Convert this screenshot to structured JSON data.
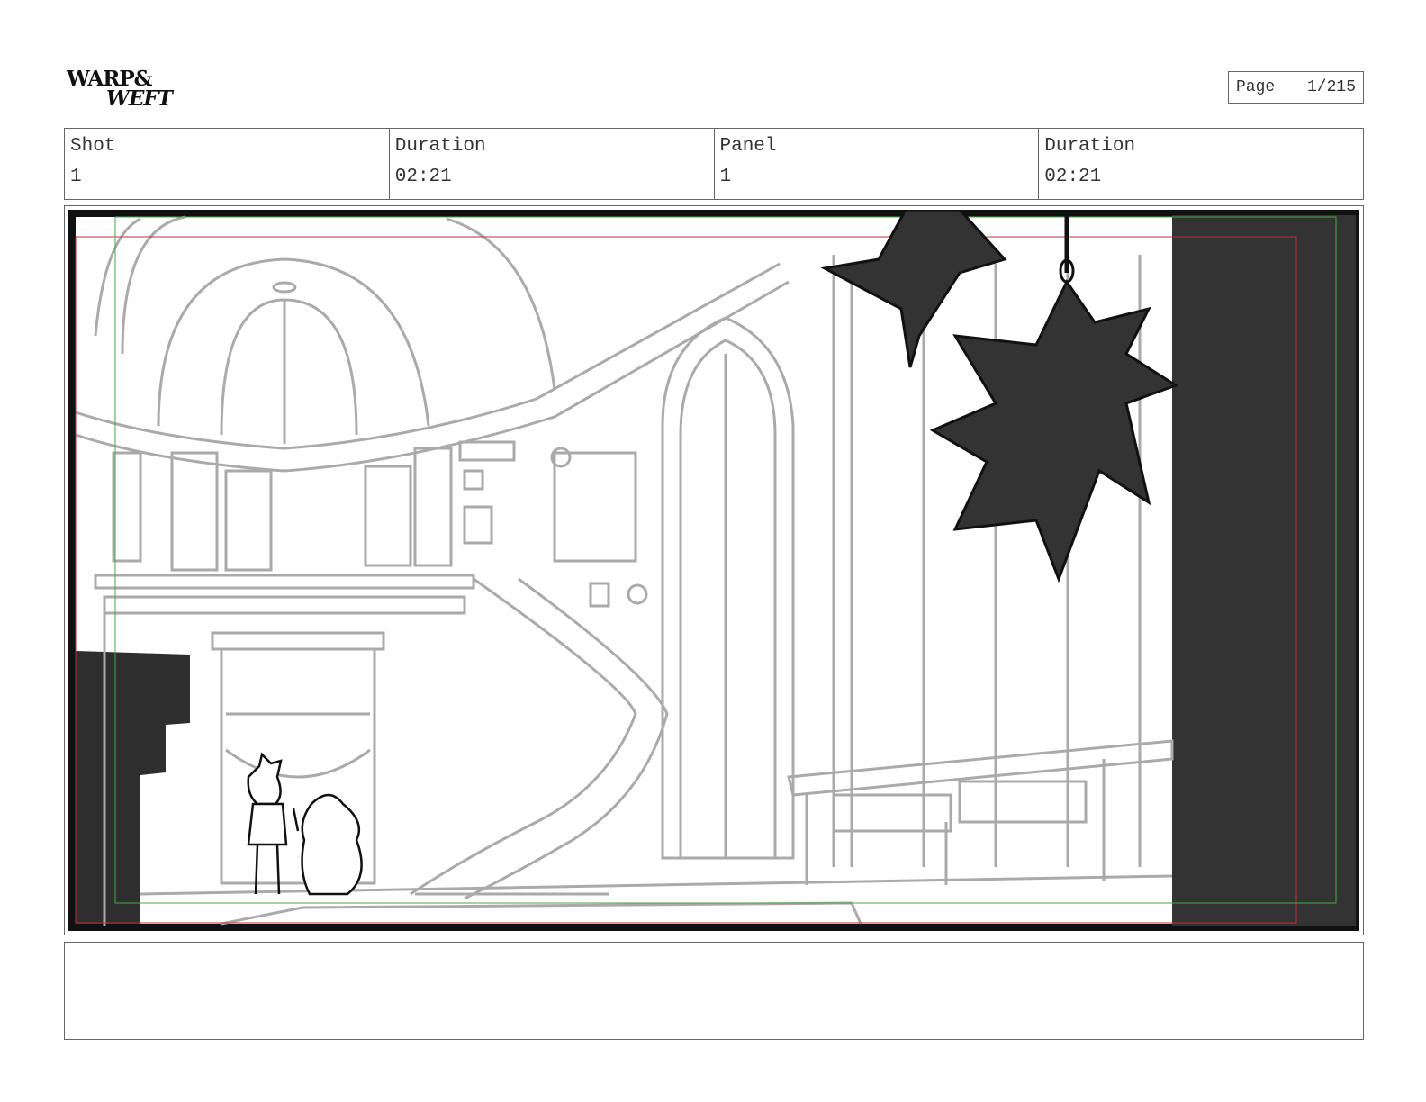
{
  "logo": {
    "line1": "WARP&",
    "line2": "WEFT"
  },
  "page": {
    "label": "Page",
    "value": "1/215"
  },
  "header": {
    "columns": [
      {
        "label": "Shot",
        "value": "1"
      },
      {
        "label": "Duration",
        "value": "02:21"
      },
      {
        "label": "Panel",
        "value": "1"
      },
      {
        "label": "Duration",
        "value": "02:21"
      }
    ]
  },
  "notes": {
    "text": ""
  }
}
